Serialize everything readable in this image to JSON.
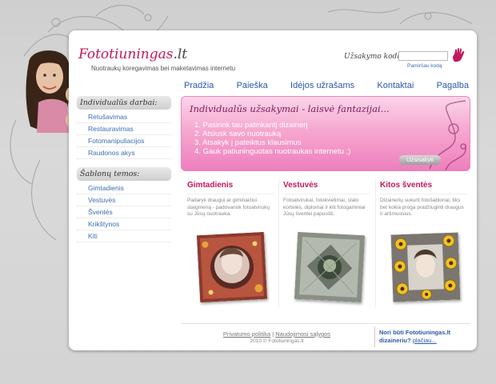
{
  "header": {
    "logo_main": "Fototiuningas",
    "logo_tld": ".lt",
    "tagline": "Nuotraukų koregavimas bei maketavimas internetu",
    "order_label": "Užsakymo kodas:",
    "order_input_value": "",
    "forgot_link": "Pamiršau kodą"
  },
  "nav": [
    "Pradžia",
    "Paieška",
    "Idėjos užrašams",
    "Kontaktai",
    "Pagalba"
  ],
  "sidebar": {
    "section1_title": "Individualūs darbai:",
    "section1_items": [
      "Retušavimas",
      "Restauravimas",
      "Fotomanipuliacijos",
      "Raudonos akys"
    ],
    "section2_title": "Šablonų temos:",
    "section2_items": [
      "Gimtadienis",
      "Vestuvės",
      "Šventės",
      "Krikštynos",
      "Kiti"
    ]
  },
  "banner": {
    "title": "Individualūs užsakymai - laisvė fantazijai...",
    "steps": [
      "1. Pasirink tau patinkantį dizainerį",
      "2. Atsiusk savo nuotrauką",
      "3. Atsakyk į pateiktus klausimus",
      "4. Gauk patiuninguotas nuotraukas internetu ;)"
    ],
    "button": "Užsisakyti"
  },
  "columns": [
    {
      "title": "Gimtadienis",
      "text": "Padaryk draugui ar giminaičiui staigmeną - padovanok fotoatvirukų su Jūsų nuotrauka."
    },
    {
      "title": "Vestuvės",
      "text": "Fotoatvirukai, fotokvietimai, stalo kortelės, diplomai ir kiti fotogaminiai Jūsų šventei papuošti."
    },
    {
      "title": "Kitos šventės",
      "text": "Dizainerių sukurti fotošablonai, tiks bet kokia proga pradžiuginti draugus ir artimuosius."
    }
  ],
  "footer": {
    "privacy": "Privatumo politika",
    "separator": "|",
    "terms": "Naudojimosi sąlygos",
    "copyright": "2010 © Fototiuningas.lt",
    "promo": "Nori būti Fototiuningas.lt dizaineriu?",
    "promo_link": "plačiau..."
  },
  "colors": {
    "accent_pink": "#c2185b",
    "link_blue": "#2a58a8",
    "banner_pink": "#ee7fbd"
  }
}
